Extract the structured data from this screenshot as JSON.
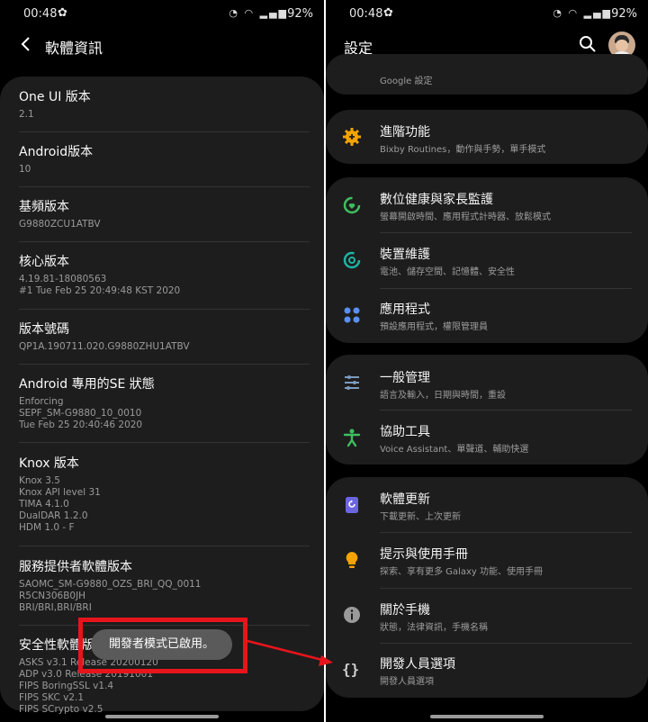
{
  "left": {
    "status": {
      "time": "00:48",
      "battery": "92%"
    },
    "header": {
      "title": "軟體資訊"
    },
    "items": [
      {
        "title": "One UI 版本",
        "sub": "2.1"
      },
      {
        "title": "Android版本",
        "sub": "10"
      },
      {
        "title": "基頻版本",
        "sub": "G9880ZCU1ATBV"
      },
      {
        "title": "核心版本",
        "sub": "4.19.81-18080563\n#1 Tue Feb 25 20:49:48 KST 2020"
      },
      {
        "title": "版本號碼",
        "sub": "QP1A.190711.020.G9880ZHU1ATBV"
      },
      {
        "title": "Android 專用的SE 狀態",
        "sub": "Enforcing\nSEPF_SM-G9880_10_0010\nTue Feb 25 20:40:46 2020"
      },
      {
        "title": "Knox 版本",
        "sub": "Knox 3.5\nKnox API level 31\nTIMA 4.1.0\nDualDAR 1.2.0\nHDM 1.0 - F"
      },
      {
        "title": "服務提供者軟體版本",
        "sub": "SAOMC_SM-G9880_OZS_BRI_QQ_0011\nR5CN306B0JH\nBRI/BRI,BRI/BRI"
      },
      {
        "title": "安全性軟體版本",
        "sub": "ASKS v3.1 Release 20200120\nADP v3.0 Release 20191001\nFIPS BoringSSL v1.4\nFIPS SKC v2.1\nFIPS SCrypto v2.5"
      }
    ],
    "toast": "開發者模式已啟用。"
  },
  "right": {
    "status": {
      "time": "00:48",
      "battery": "92%"
    },
    "header": {
      "title": "設定"
    },
    "partial": "Google 設定",
    "rows": [
      {
        "title": "進階功能",
        "sub": "Bixby Routines，動作與手勢，單手模式",
        "icon": "gear-plus-icon",
        "color": "#f4a300"
      },
      {
        "title": "數位健康與家長監護",
        "sub": "螢幕開啟時間、應用程式計時器、放鬆模式",
        "icon": "digital-wellbeing-icon",
        "color": "#3fbe5f"
      },
      {
        "title": "裝置維護",
        "sub": "電池、儲存空間、記憶體、安全性",
        "icon": "device-care-icon",
        "color": "#1fb3a3"
      },
      {
        "title": "應用程式",
        "sub": "預設應用程式，權限管理員",
        "icon": "apps-icon",
        "color": "#5b8ff0"
      },
      {
        "title": "一般管理",
        "sub": "語言及輸入，日期與時間，重設",
        "icon": "sliders-icon",
        "color": "#7d9bbd"
      },
      {
        "title": "協助工具",
        "sub": "Voice Assistant、單聲道、輔助快選",
        "icon": "accessibility-icon",
        "color": "#3fbe5f"
      },
      {
        "title": "軟體更新",
        "sub": "下載更新、上次更新",
        "icon": "software-update-icon",
        "color": "#6b65e0"
      },
      {
        "title": "提示與使用手冊",
        "sub": "探索、享有更多 Galaxy 功能、使用手冊",
        "icon": "lightbulb-icon",
        "color": "#f4a300"
      },
      {
        "title": "關於手機",
        "sub": "狀態，法律資訊，手機名稱",
        "icon": "info-icon",
        "color": "#9a9a9a"
      },
      {
        "title": "開發人員選項",
        "sub": "開發人員選項",
        "icon": "braces-icon",
        "color": "#cfcfcf"
      }
    ]
  }
}
